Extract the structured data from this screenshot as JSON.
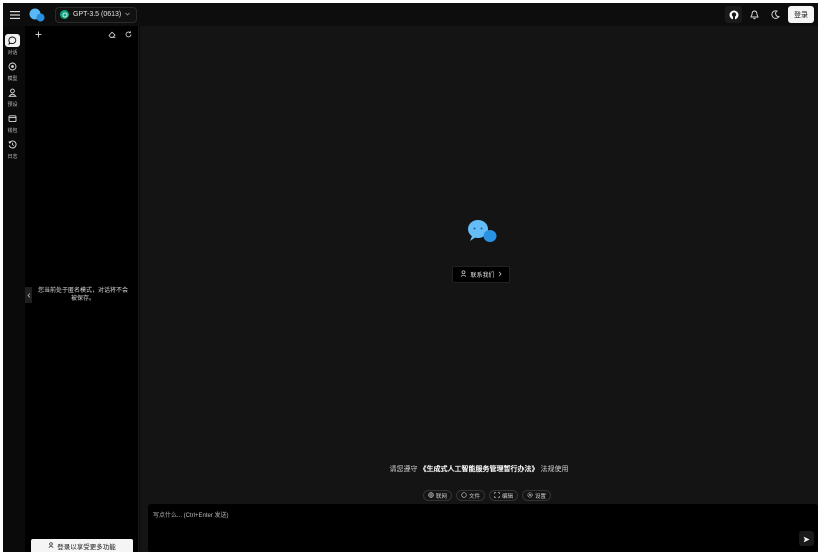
{
  "header": {
    "model_name": "GPT-3.5 (0613)",
    "login_label": "登录"
  },
  "rail": {
    "items": [
      {
        "label": "对话",
        "icon": "chat-bubble-icon",
        "active": true
      },
      {
        "label": "模型",
        "icon": "model-target-icon",
        "active": false
      },
      {
        "label": "预设",
        "icon": "preset-person-icon",
        "active": false
      },
      {
        "label": "钱包",
        "icon": "wallet-icon",
        "active": false
      },
      {
        "label": "日志",
        "icon": "history-clock-icon",
        "active": false
      }
    ]
  },
  "panel": {
    "incognito_message": "您当前处于匿名模式，对话将不会被保存。",
    "login_button": "登录以享受更多功能"
  },
  "main": {
    "contact_label": "联系我们",
    "notice_prefix": "请您遵守",
    "notice_law": "《生成式人工智能服务管理暂行办法》",
    "notice_suffix": "法规使用",
    "tools": [
      "联网",
      "文件",
      "编辑",
      "设置"
    ],
    "input_placeholder": "写点什么... (Ctrl+Enter 发送)"
  },
  "colors": {
    "background": "#141414",
    "panel": "#000000",
    "accent_blue": "#2a9df4",
    "model_green": "#10a37f"
  }
}
